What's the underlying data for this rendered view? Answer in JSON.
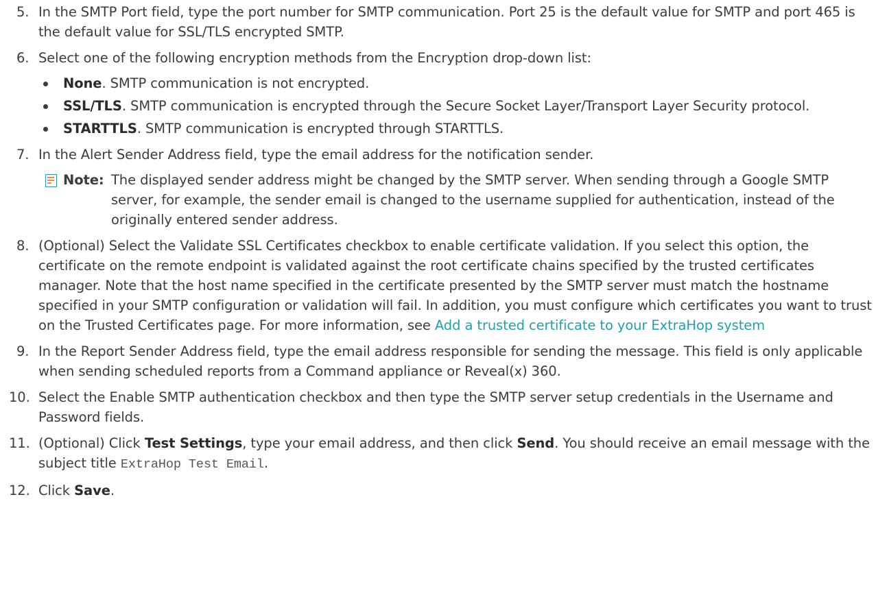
{
  "steps": {
    "s5": {
      "num": "5.",
      "text": "In the SMTP Port field, type the port number for SMTP communication. Port 25 is the default value for SMTP and port 465 is the default value for SSL/TLS encrypted SMTP."
    },
    "s6": {
      "num": "6.",
      "text": "Select one of the following encryption methods from the Encryption drop-down list:",
      "options": [
        {
          "name": "None",
          "desc": ". SMTP communication is not encrypted."
        },
        {
          "name": "SSL/TLS",
          "desc": ". SMTP communication is encrypted through the Secure Socket Layer/Transport Layer Security protocol."
        },
        {
          "name": "STARTTLS",
          "desc": ". SMTP communication is encrypted through STARTTLS."
        }
      ]
    },
    "s7": {
      "num": "7.",
      "text": "In the Alert Sender Address field, type the email address for the notification sender.",
      "note_label": "Note:",
      "note_text": "The displayed sender address might be changed by the SMTP server. When sending through a Google SMTP server, for example, the sender email is changed to the username supplied for authentication, instead of the originally entered sender address."
    },
    "s8": {
      "num": "8.",
      "text": "(Optional) Select the Validate SSL Certificates checkbox to enable certificate validation. If you select this option, the certificate on the remote endpoint is validated against the root certificate chains specified by the trusted certificates manager. Note that the host name specified in the certificate presented by the SMTP server must match the hostname specified in your SMTP configuration or validation will fail. In addition, you must configure which certificates you want to trust on the Trusted Certificates page. For more information, see ",
      "link": "Add a trusted certificate to your ExtraHop system"
    },
    "s9": {
      "num": "9.",
      "text": "In the Report Sender Address field, type the email address responsible for sending the message. This field is only applicable when sending scheduled reports from a Command appliance or Reveal(x) 360."
    },
    "s10": {
      "num": "10.",
      "text": "Select the Enable SMTP authentication checkbox and then type the SMTP server setup credentials in the Username and Password fields."
    },
    "s11": {
      "num": "11.",
      "pre": "(Optional) Click ",
      "bold1": "Test Settings",
      "mid": ", type your email address, and then click ",
      "bold2": "Send",
      "post": ". You should receive an email message with the subject title ",
      "code": "ExtraHop Test Email",
      "end": "."
    },
    "s12": {
      "num": "12.",
      "pre": "Click ",
      "bold": "Save",
      "end": "."
    }
  },
  "colors": {
    "text": "#3c3c3c",
    "link": "#1e9fb3",
    "note_icon_border": "#2f96b4",
    "note_icon_lines": "#f08a4b"
  },
  "icons": {
    "note": "note-icon"
  }
}
